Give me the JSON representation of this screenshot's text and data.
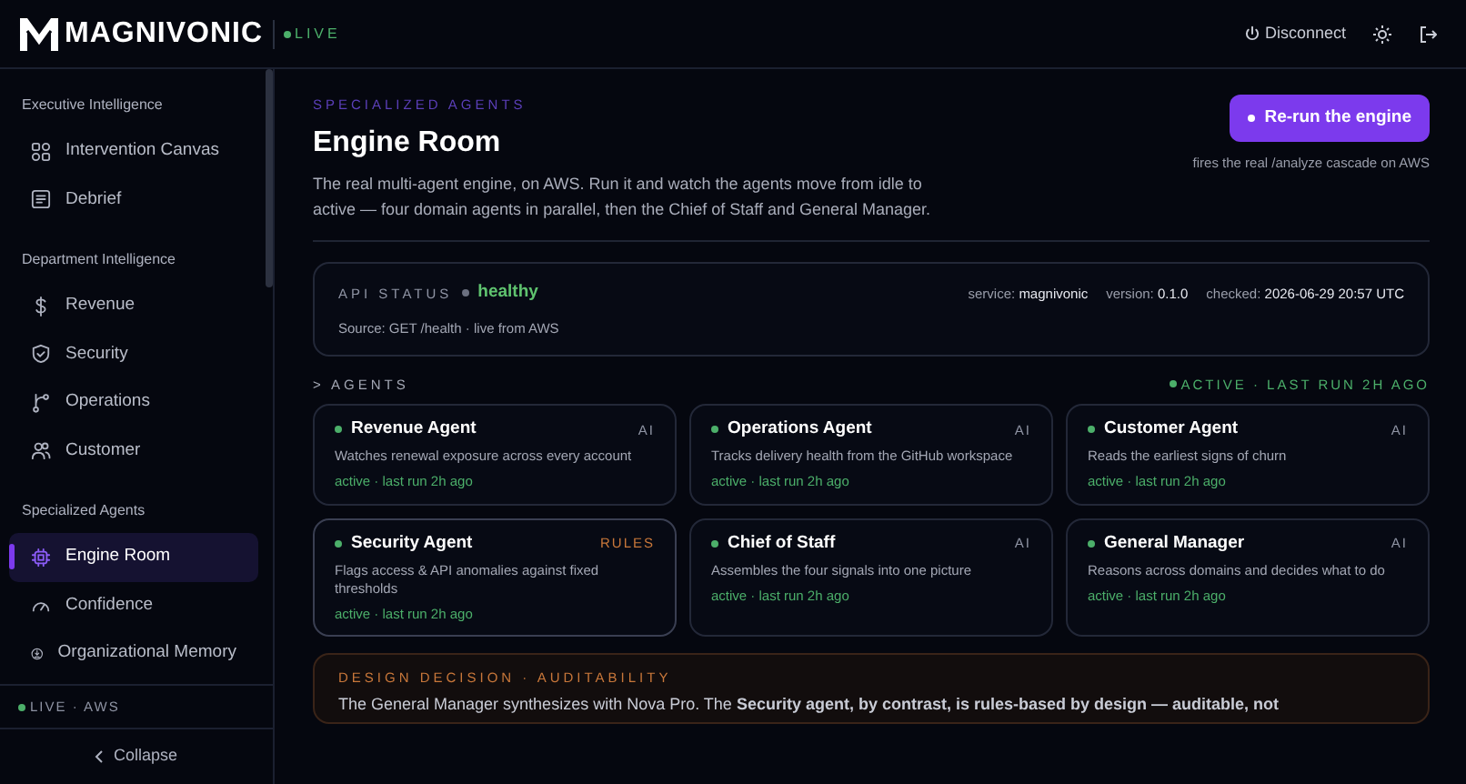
{
  "header": {
    "brand": "MAGNIVONIC",
    "live": "LIVE",
    "disconnect": "Disconnect"
  },
  "sidebar": {
    "sections": [
      {
        "title": "Executive Intelligence",
        "items": [
          {
            "label": "Intervention Canvas",
            "selected": false
          },
          {
            "label": "Debrief",
            "selected": false
          }
        ]
      },
      {
        "title": "Department Intelligence",
        "items": [
          {
            "label": "Revenue",
            "selected": false
          },
          {
            "label": "Security",
            "selected": false
          },
          {
            "label": "Operations",
            "selected": false
          },
          {
            "label": "Customer",
            "selected": false
          }
        ]
      },
      {
        "title": "Specialized Agents",
        "items": [
          {
            "label": "Engine Room",
            "selected": true
          },
          {
            "label": "Confidence",
            "selected": false
          },
          {
            "label": "Organizational Memory",
            "selected": false
          }
        ]
      }
    ],
    "status": "LIVE · AWS",
    "collapse": "Collapse"
  },
  "page": {
    "eyebrow": "SPECIALIZED AGENTS",
    "title": "Engine Room",
    "description": "The real multi-agent engine, on AWS. Run it and watch the agents move from idle to active — four domain agents in parallel, then the Chief of Staff and General Manager.",
    "button": "Re-run the engine",
    "button_note": "fires the real /analyze cascade on AWS"
  },
  "api_status": {
    "label": "API STATUS",
    "state": "healthy",
    "source": "Source: GET /health · live from AWS",
    "meta": [
      {
        "label": "service:",
        "value": "magnivonic"
      },
      {
        "label": "version:",
        "value": "0.1.0"
      },
      {
        "label": "checked:",
        "value": "2026-06-29 20:57 UTC"
      }
    ]
  },
  "agents": {
    "heading": "> AGENTS",
    "status": "ACTIVE · LAST RUN 2H AGO",
    "cards": [
      {
        "name": "Revenue Agent",
        "kind": "ai",
        "tag": "AI",
        "description": "Watches renewal exposure across every account",
        "status": "active · last run 2h ago"
      },
      {
        "name": "Operations Agent",
        "kind": "ai",
        "tag": "AI",
        "description": "Tracks delivery health from the GitHub workspace",
        "status": "active · last run 2h ago"
      },
      {
        "name": "Customer Agent",
        "kind": "ai",
        "tag": "AI",
        "description": "Reads the earliest signs of churn",
        "status": "active · last run 2h ago"
      },
      {
        "name": "Security Agent",
        "kind": "rules",
        "tag": "RULES",
        "description": "Flags access & API anomalies against fixed thresholds",
        "status": "active · last run 2h ago"
      },
      {
        "name": "Chief of Staff",
        "kind": "ai",
        "tag": "AI",
        "description": "Assembles the four signals into one picture",
        "status": "active · last run 2h ago"
      },
      {
        "name": "General Manager",
        "kind": "ai",
        "tag": "AI",
        "description": "Reasons across domains and decides what to do",
        "status": "active · last run 2h ago"
      }
    ]
  },
  "decision": {
    "heading": "DESIGN DECISION · AUDITABILITY",
    "text": "The General Manager synthesizes with Nova Pro. The **Security agent, by contrast, is rules-based by design — auditable, not**"
  }
}
